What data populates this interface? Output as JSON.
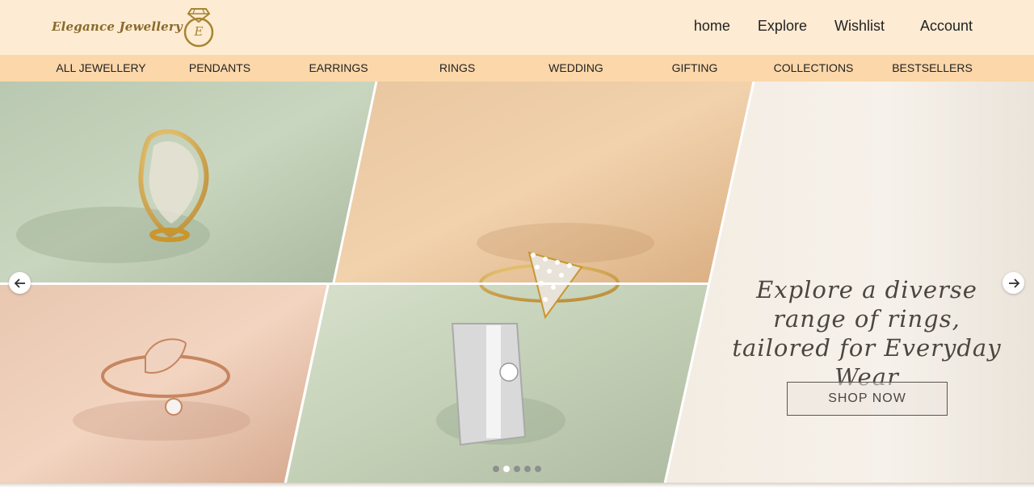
{
  "header": {
    "logo_text": "Elegance Jewellery",
    "logo_letter": "E",
    "nav": [
      {
        "label": "home"
      },
      {
        "label": "Explore"
      },
      {
        "label": "Wishlist"
      },
      {
        "label": "Account"
      }
    ]
  },
  "categories": [
    {
      "label": "ALL JEWELLERY"
    },
    {
      "label": "PENDANTS"
    },
    {
      "label": "EARRINGS"
    },
    {
      "label": "RINGS"
    },
    {
      "label": "WEDDING"
    },
    {
      "label": "GIFTING"
    },
    {
      "label": "COLLECTIONS"
    },
    {
      "label": "BESTSELLERS"
    }
  ],
  "hero": {
    "tagline": "Explore a diverse range of rings, tailored for Everyday Wear",
    "cta_label": "SHOP NOW",
    "slide_count": 5,
    "active_slide": 2
  },
  "colors": {
    "header_bg": "#fdebd3",
    "category_bg": "#fcd7a9",
    "logo_gold": "#a7842f",
    "text_dark": "#222222"
  },
  "icons": {
    "logo": "diamond-ring-icon",
    "prev": "arrow-left-icon",
    "next": "arrow-right-icon"
  }
}
